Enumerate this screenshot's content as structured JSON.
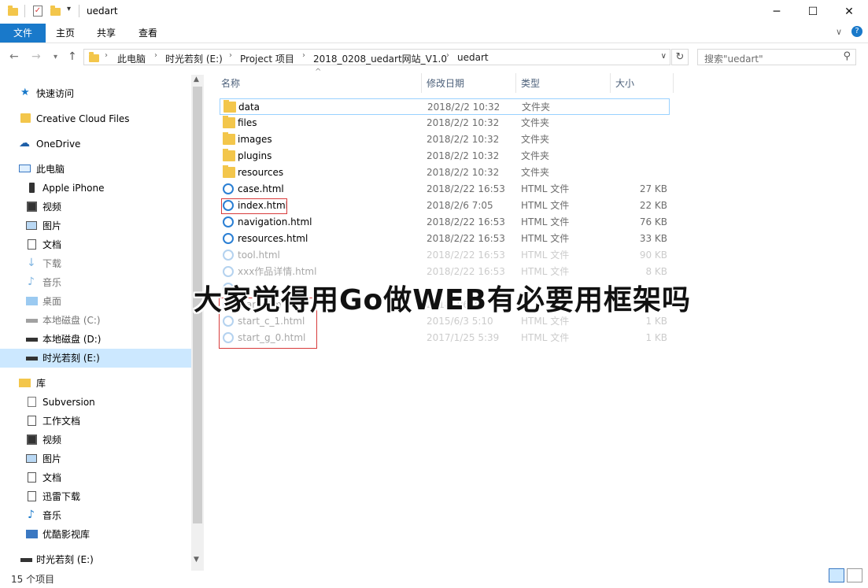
{
  "window": {
    "title": "uedart",
    "controls": {
      "minimize": "─",
      "maximize": "☐",
      "close": "✕"
    }
  },
  "ribbon": {
    "tabs": [
      "文件",
      "主页",
      "共享",
      "查看"
    ]
  },
  "address": {
    "crumbs": [
      "此电脑",
      "时光若刻 (E:)",
      "Project 项目",
      "2018_0208_uedart网站_V1.0",
      "uedart"
    ],
    "search_placeholder": "搜索\"uedart\""
  },
  "nav": {
    "items": [
      {
        "label": "快速访问",
        "icon": "star-icon"
      },
      {
        "label": "Creative Cloud Files",
        "icon": "cc-folder-icon"
      },
      {
        "label": "OneDrive",
        "icon": "cloud-icon"
      },
      {
        "label": "此电脑",
        "icon": "pc-icon"
      },
      {
        "label": "Apple iPhone",
        "icon": "phone-icon"
      },
      {
        "label": "视频",
        "icon": "video-icon"
      },
      {
        "label": "图片",
        "icon": "picture-icon"
      },
      {
        "label": "文档",
        "icon": "document-icon"
      },
      {
        "label": "下载",
        "icon": "download-icon"
      },
      {
        "label": "音乐",
        "icon": "music-icon"
      },
      {
        "label": "桌面",
        "icon": "desktop-icon"
      },
      {
        "label": "本地磁盘 (C:)",
        "icon": "drive-icon"
      },
      {
        "label": "本地磁盘 (D:)",
        "icon": "drive-icon"
      },
      {
        "label": "时光若刻 (E:)",
        "icon": "drive-icon"
      },
      {
        "label": "库",
        "icon": "library-icon"
      },
      {
        "label": "Subversion",
        "icon": "file-icon"
      },
      {
        "label": "工作文档",
        "icon": "document-icon"
      },
      {
        "label": "视频",
        "icon": "video-icon"
      },
      {
        "label": "图片",
        "icon": "picture-icon"
      },
      {
        "label": "文档",
        "icon": "document-icon"
      },
      {
        "label": "迅雷下载",
        "icon": "document-icon"
      },
      {
        "label": "音乐",
        "icon": "music-icon"
      },
      {
        "label": "优酷影视库",
        "icon": "library-icon"
      },
      {
        "label": "时光若刻 (E:)",
        "icon": "drive-icon"
      }
    ]
  },
  "columns": {
    "name": "名称",
    "date": "修改日期",
    "type": "类型",
    "size": "大小"
  },
  "files": [
    {
      "name": "data",
      "date": "2018/2/2 10:32",
      "type": "文件夹",
      "size": "",
      "kind": "folder"
    },
    {
      "name": "files",
      "date": "2018/2/2 10:32",
      "type": "文件夹",
      "size": "",
      "kind": "folder"
    },
    {
      "name": "images",
      "date": "2018/2/2 10:32",
      "type": "文件夹",
      "size": "",
      "kind": "folder"
    },
    {
      "name": "plugins",
      "date": "2018/2/2 10:32",
      "type": "文件夹",
      "size": "",
      "kind": "folder"
    },
    {
      "name": "resources",
      "date": "2018/2/2 10:32",
      "type": "文件夹",
      "size": "",
      "kind": "folder"
    },
    {
      "name": "case.html",
      "date": "2018/2/22 16:53",
      "type": "HTML 文件",
      "size": "27 KB",
      "kind": "html"
    },
    {
      "name": "index.html",
      "date": "2018/2/6 7:05",
      "type": "HTML 文件",
      "size": "22 KB",
      "kind": "html"
    },
    {
      "name": "navigation.html",
      "date": "2018/2/22 16:53",
      "type": "HTML 文件",
      "size": "76 KB",
      "kind": "html"
    },
    {
      "name": "resources.html",
      "date": "2018/2/22 16:53",
      "type": "HTML 文件",
      "size": "33 KB",
      "kind": "html"
    },
    {
      "name": "tool.html",
      "date": "2018/2/22 16:53",
      "type": "HTML 文件",
      "size": "90 KB",
      "kind": "html"
    },
    {
      "name": "xxx作品详情.html",
      "date": "2018/2/22 16:53",
      "type": "HTML 文件",
      "size": "8 KB",
      "kind": "html"
    },
    {
      "name": "",
      "date": "",
      "type": "",
      "size": "",
      "kind": "html"
    },
    {
      "name": "start.htm",
      "date": "2018/2/6 7",
      "type": "",
      "size": "22 KB",
      "kind": "html"
    },
    {
      "name": "start_c_1.html",
      "date": "2015/6/3 5:10",
      "type": "HTML 文件",
      "size": "1 KB",
      "kind": "html"
    },
    {
      "name": "start_g_0.html",
      "date": "2017/1/25 5:39",
      "type": "HTML 文件",
      "size": "1 KB",
      "kind": "html"
    }
  ],
  "overlay_text": "大家觉得用Go做WEB有必要用框架吗",
  "status": "15 个项目",
  "colors": {
    "accent": "#1979ca",
    "folder": "#f3c64b",
    "selection": "#cce8ff",
    "highlight_box": "#d83b3b"
  }
}
